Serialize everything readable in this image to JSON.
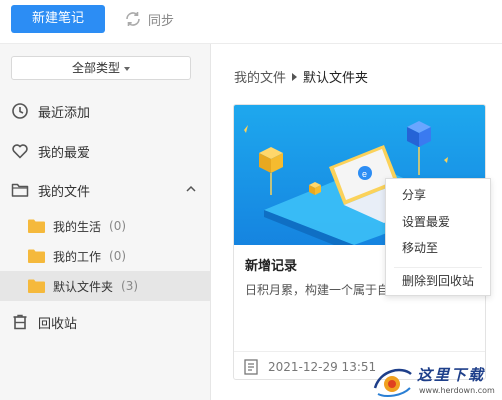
{
  "toolbar": {
    "new_note_label": "新建笔记",
    "sync_label": "同步"
  },
  "sidebar": {
    "type_filter": "全部类型",
    "recent_label": "最近添加",
    "favorites_label": "我的最爱",
    "my_files_label": "我的文件",
    "folders": [
      {
        "label": "我的生活",
        "count": "(0)"
      },
      {
        "label": "我的工作",
        "count": "(0)"
      },
      {
        "label": "默认文件夹",
        "count": "(3)"
      }
    ],
    "trash_label": "回收站"
  },
  "breadcrumb": {
    "root": "我的文件",
    "current": "默认文件夹"
  },
  "note_card": {
    "title": "新增记录",
    "excerpt": "日积月累，构建一个属于自",
    "timestamp": "2021-12-29  13:51"
  },
  "context_menu": {
    "items": [
      "分享",
      "设置最爱",
      "移动至",
      "删除到回收站"
    ]
  },
  "watermark": {
    "title": "这里下载",
    "url": "www.herdown.com"
  },
  "colors": {
    "accent": "#2c8df4",
    "folder": "#f5b93c",
    "sidebar_bg": "#f6f6f6",
    "active_bg": "#e6e6e6"
  }
}
